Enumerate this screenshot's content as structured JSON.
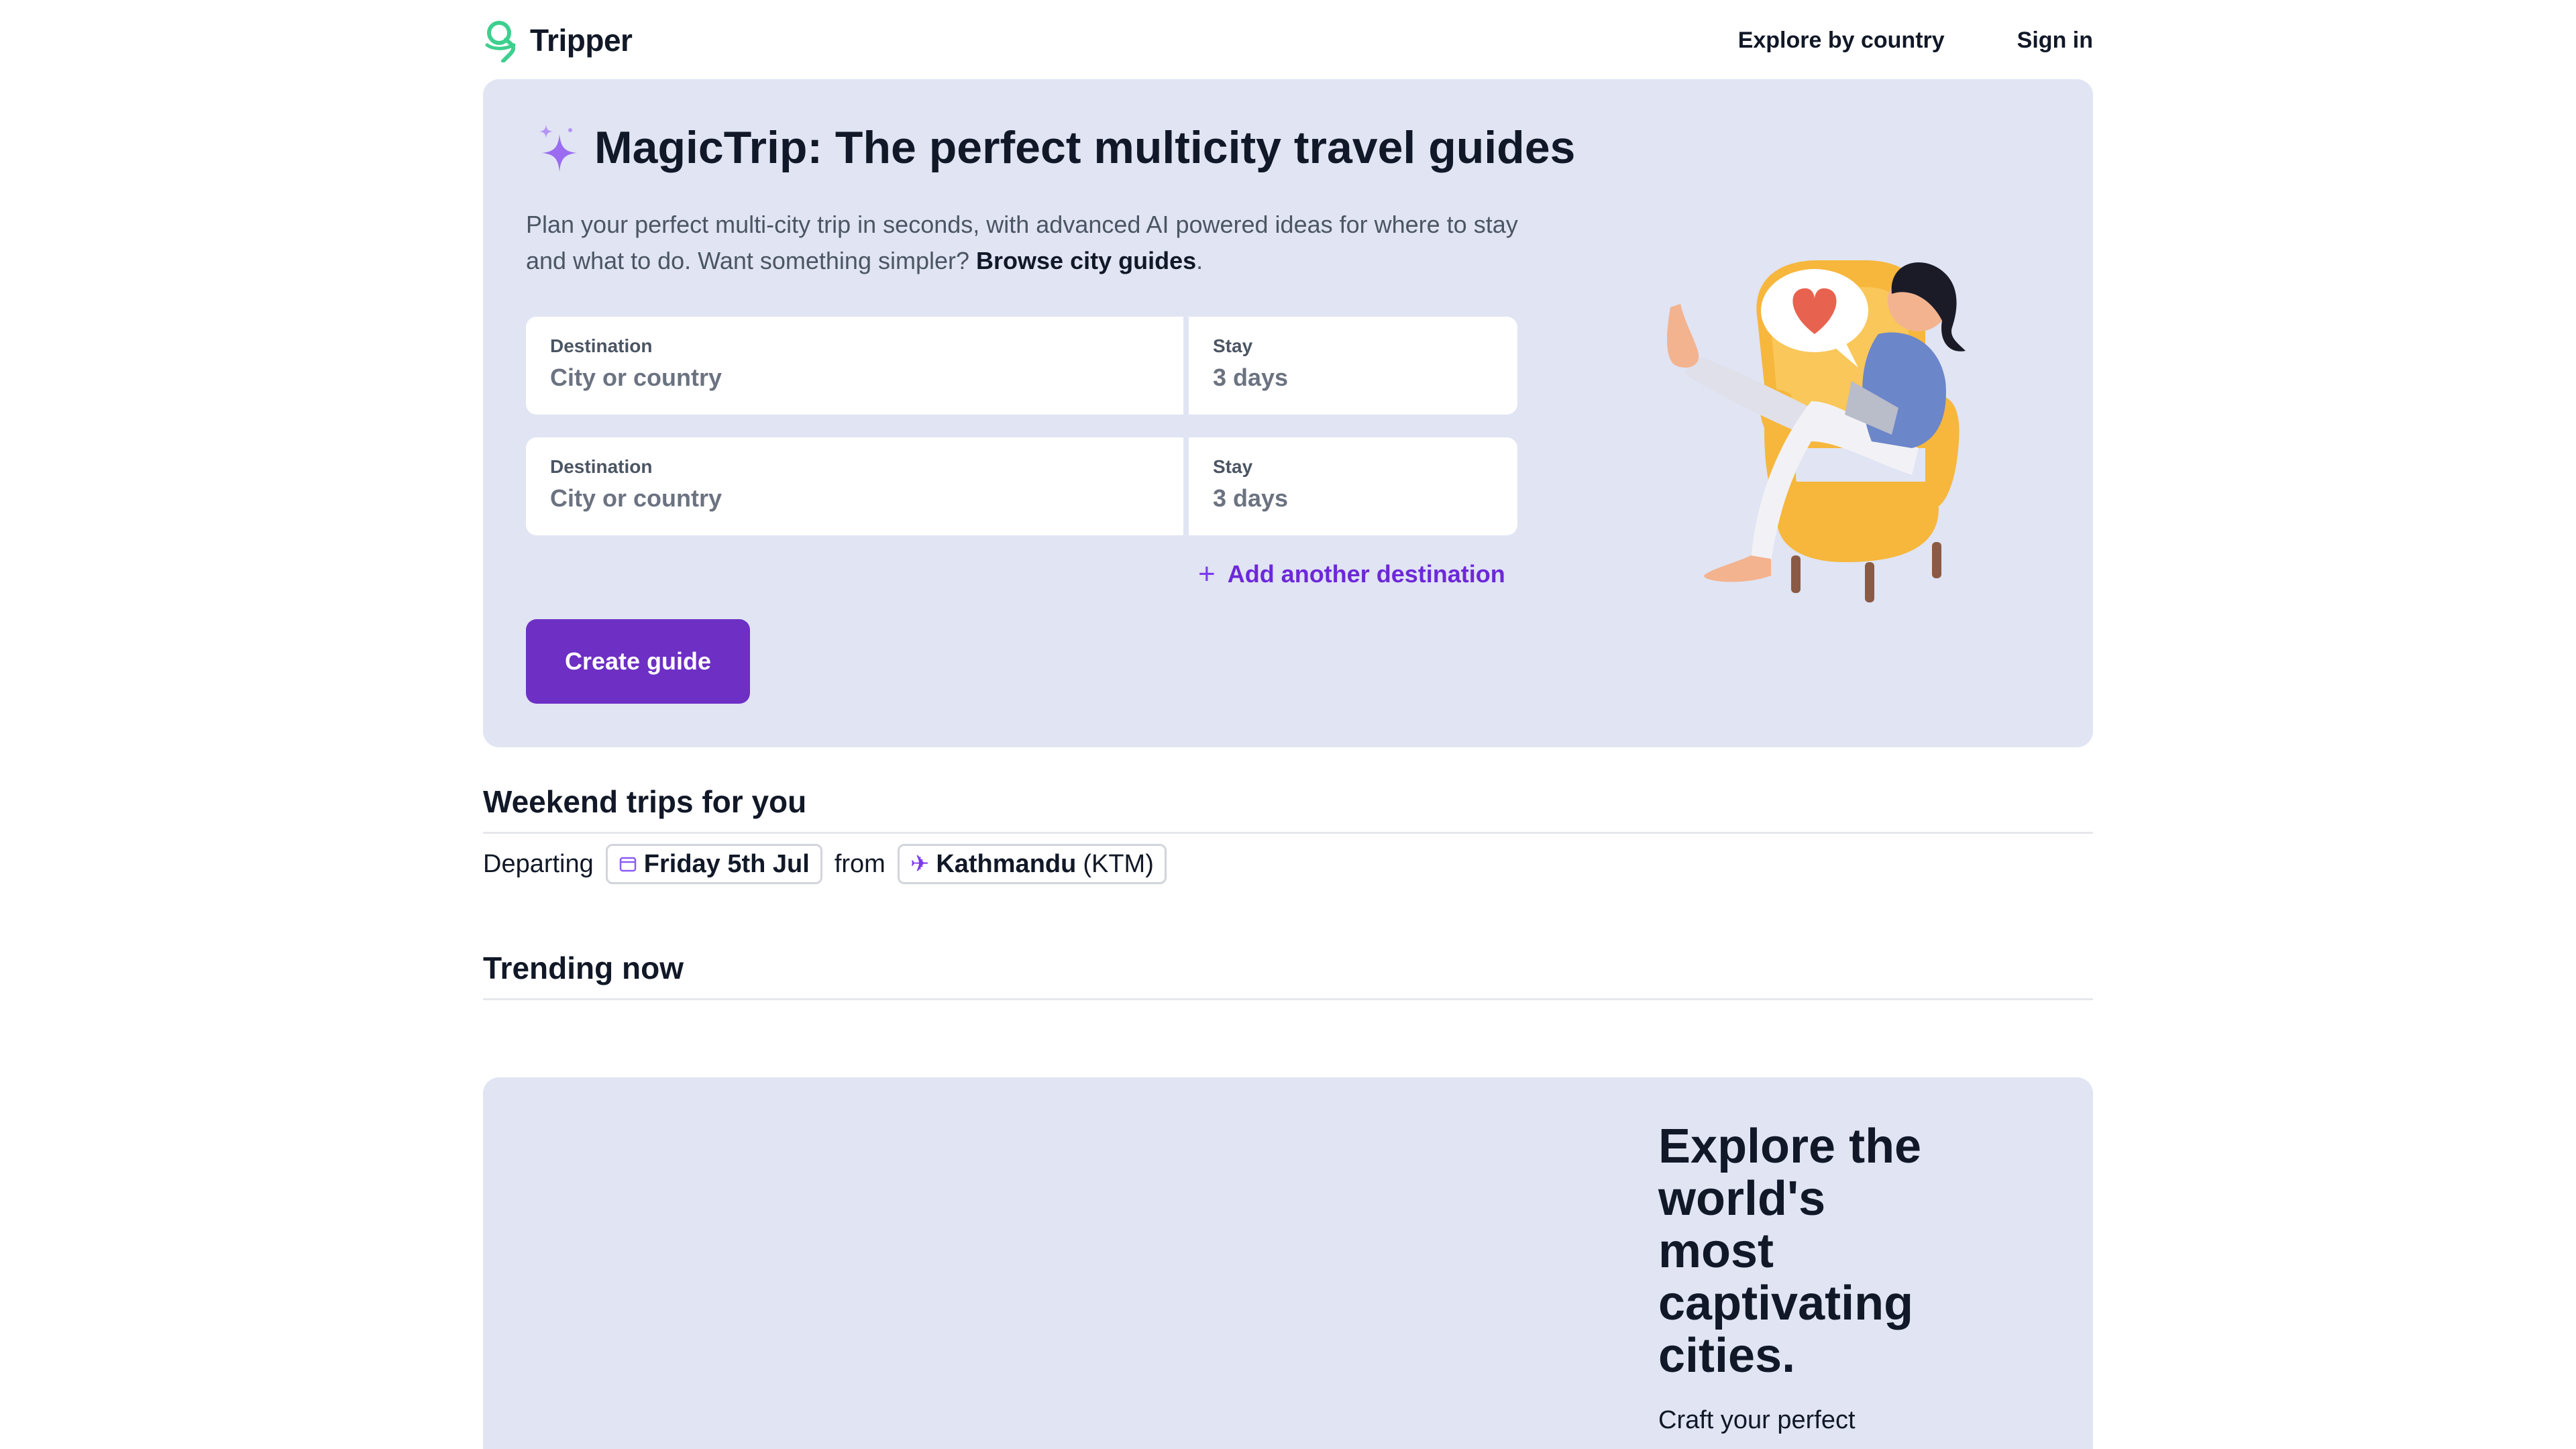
{
  "header": {
    "logo_text": "Tripper",
    "nav": {
      "explore_label": "Explore by country",
      "signin_label": "Sign in"
    }
  },
  "hero": {
    "title_brand": "MagicTrip",
    "title_rest": ": The perfect multicity travel guides",
    "description": "Plan your perfect multi-city trip in seconds, with advanced AI powered ideas for where to stay and what to do. Want something simpler?",
    "browse_link": "Browse city guides",
    "description_end": ".",
    "destinations": [
      {
        "dest_label": "Destination",
        "dest_placeholder": "City or country",
        "stay_label": "Stay",
        "stay_value": "3 days"
      },
      {
        "dest_label": "Destination",
        "dest_placeholder": "City or country",
        "stay_label": "Stay",
        "stay_value": "3 days"
      }
    ],
    "add_destination": "Add another destination",
    "create_button": "Create guide"
  },
  "weekend": {
    "title": "Weekend trips for you",
    "departing_label": "Departing",
    "date": "Friday 5th Jul",
    "from_label": "from",
    "origin_city": "Kathmandu",
    "origin_code": "(KTM)"
  },
  "trending": {
    "title": "Trending now"
  },
  "explore": {
    "title": "Explore the world's most captivating cities.",
    "desc": "Craft your perfect"
  },
  "colors": {
    "accent": "#6d2fc4",
    "panel": "#e0e4f3",
    "logo": "#3ecf8e"
  },
  "icons": {
    "logo": "tripper-logo-icon",
    "sparkle": "sparkle-icon",
    "plus": "plus-icon",
    "calendar": "calendar-icon",
    "plane": "airplane-icon"
  }
}
